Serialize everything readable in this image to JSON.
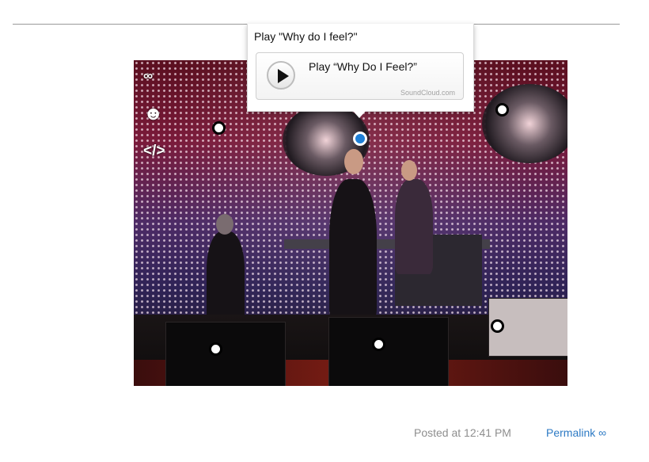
{
  "tooltip": {
    "title": "Play \"Why do I feel?\"",
    "track_label": "Play “Why Do I Feel?”",
    "brand": "SoundCloud.com"
  },
  "photo": {
    "side_icons": [
      "link-icon",
      "people-icon",
      "embed-code-icon"
    ]
  },
  "footer": {
    "posted": "Posted at 12:41 PM",
    "permalink": "Permalink ∞"
  }
}
